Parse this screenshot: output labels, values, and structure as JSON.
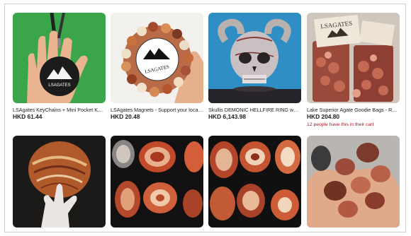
{
  "listings": [
    {
      "title": "LSAgates KeyChains + Mini Pocket Knif...",
      "price": "HKD 61.44",
      "image": "keychain-photo",
      "logo_text": "LSAGATES"
    },
    {
      "title": "LSAgates Magnets - Support your local r...",
      "price": "HKD 20.48",
      "image": "magnets-photo",
      "logo_text": "LSAGATES"
    },
    {
      "title": "Skullis DEMONIC HELLFIRE RING worn...",
      "price": "HKD 6,143.98",
      "image": "skull-ring-photo"
    },
    {
      "title": "Lake Superior Agate Goodie Bags - Ran...",
      "price": "HKD 204.80",
      "image": "agate-bags-photo",
      "note": "12 people have this in their cart",
      "logo_text": "LSAGATES"
    },
    {
      "title": "",
      "price": "",
      "image": "agate-hand-sculpture-photo"
    },
    {
      "title": "",
      "price": "",
      "image": "polished-agates-photo"
    },
    {
      "title": "",
      "price": "",
      "image": "agate-slices-photo"
    },
    {
      "title": "",
      "price": "",
      "image": "agates-in-hand-photo"
    }
  ],
  "colors": {
    "note_red": "#a61a2b",
    "frame_border": "#cfcfcf"
  }
}
